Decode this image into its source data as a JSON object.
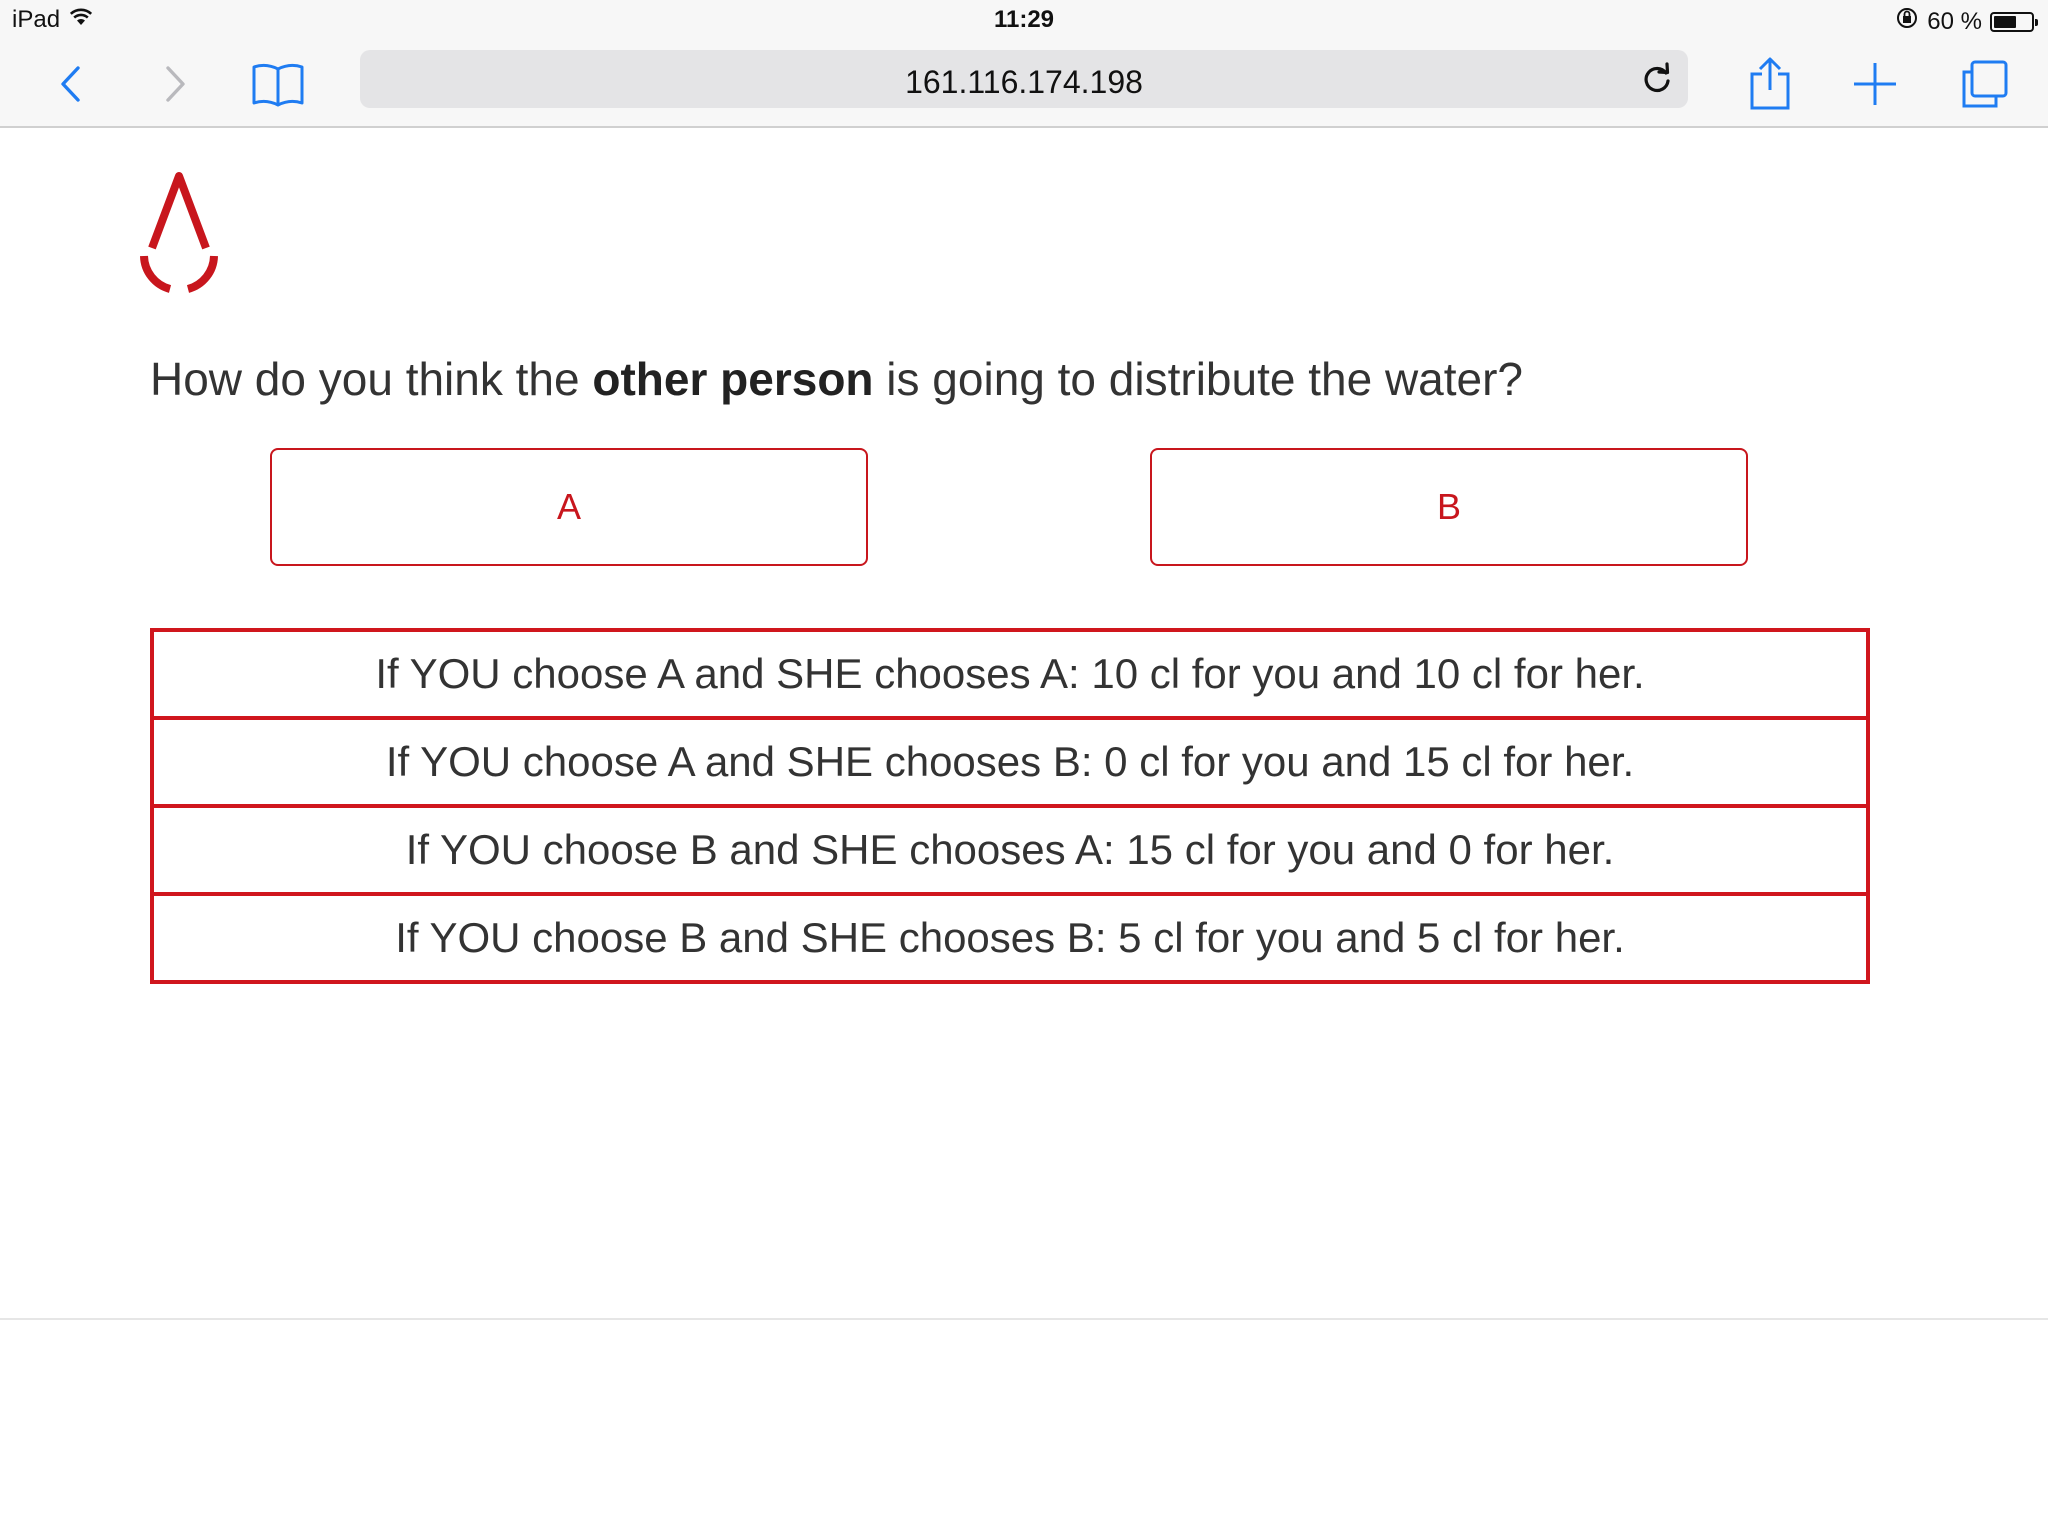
{
  "status_bar": {
    "device": "iPad",
    "time": "11:29",
    "battery_text": "60 %",
    "battery_level": 0.6
  },
  "browser": {
    "url": "161.116.174.198"
  },
  "page": {
    "question_before": "How do you think the ",
    "question_bold": "other person",
    "question_after": " is going to distribute the water?",
    "choices": [
      {
        "label": "A"
      },
      {
        "label": "B"
      }
    ],
    "payoffs": [
      "If YOU choose A and SHE chooses A: 10 cl for you and 10 cl for her.",
      "If YOU choose A and SHE chooses B: 0 cl for you and 15 cl for her.",
      "If YOU choose B and SHE chooses A: 15 cl for you and 0 for her.",
      "If YOU choose B and SHE chooses B: 5 cl for you and 5 cl for her."
    ]
  },
  "colors": {
    "accent": "#d0161d",
    "ios_blue": "#1f7cf2"
  },
  "icons": [
    "wifi-icon",
    "lock-rotation-icon",
    "back-icon",
    "forward-icon",
    "bookmarks-icon",
    "reload-icon",
    "share-icon",
    "new-tab-icon",
    "tabs-icon",
    "water-drop-logo"
  ]
}
